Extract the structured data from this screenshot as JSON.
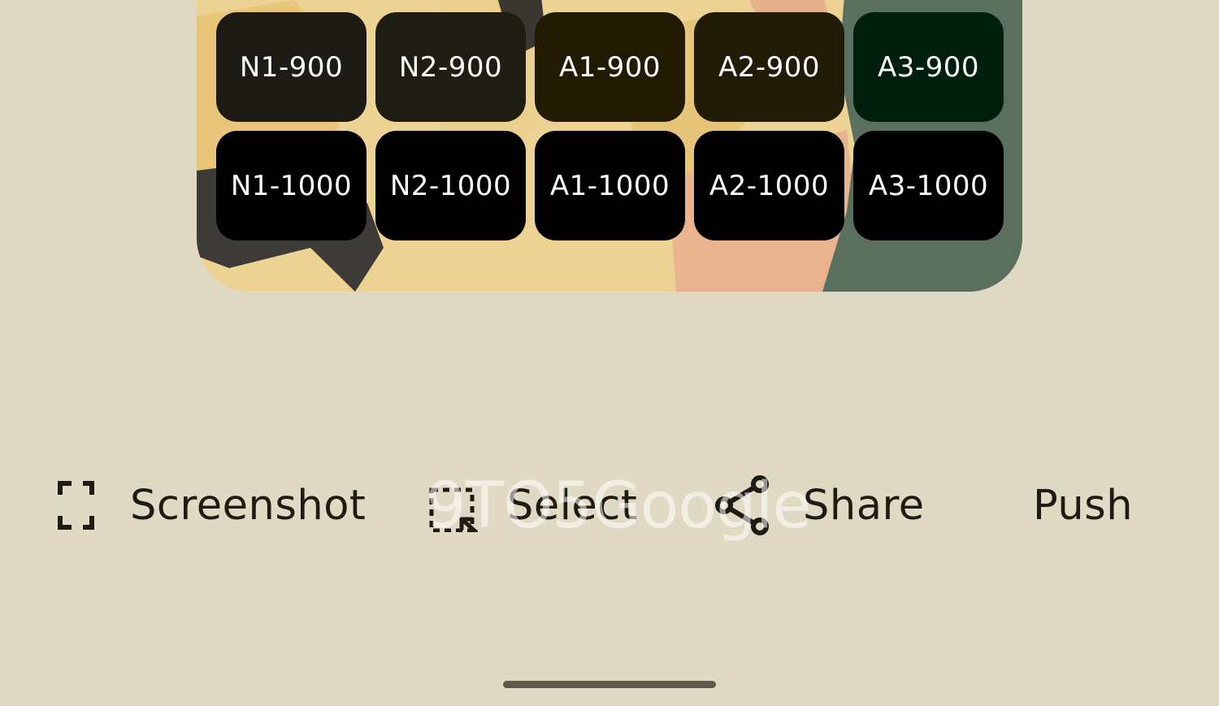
{
  "palette_tiles": [
    {
      "label": "N1-900",
      "color": "#1d1b15"
    },
    {
      "label": "N2-900",
      "color": "#1f1c12"
    },
    {
      "label": "A1-900",
      "color": "#211b04"
    },
    {
      "label": "A2-900",
      "color": "#211c08"
    },
    {
      "label": "A3-900",
      "color": "#00200f"
    },
    {
      "label": "N1-1000",
      "color": "#000000"
    },
    {
      "label": "N2-1000",
      "color": "#000000"
    },
    {
      "label": "A1-1000",
      "color": "#000000"
    },
    {
      "label": "A2-1000",
      "color": "#000000"
    },
    {
      "label": "A3-1000",
      "color": "#000000"
    }
  ],
  "actions": {
    "screenshot": {
      "label": "Screenshot",
      "icon": "screenshot-frame-icon"
    },
    "select": {
      "label": "Select",
      "icon": "select-region-icon"
    },
    "share": {
      "label": "Share",
      "icon": "share-icon"
    },
    "push": {
      "label": "Push"
    }
  },
  "watermark": "9TO5Google",
  "colors": {
    "background": "#e0d9c4",
    "text": "#1e1b13"
  }
}
